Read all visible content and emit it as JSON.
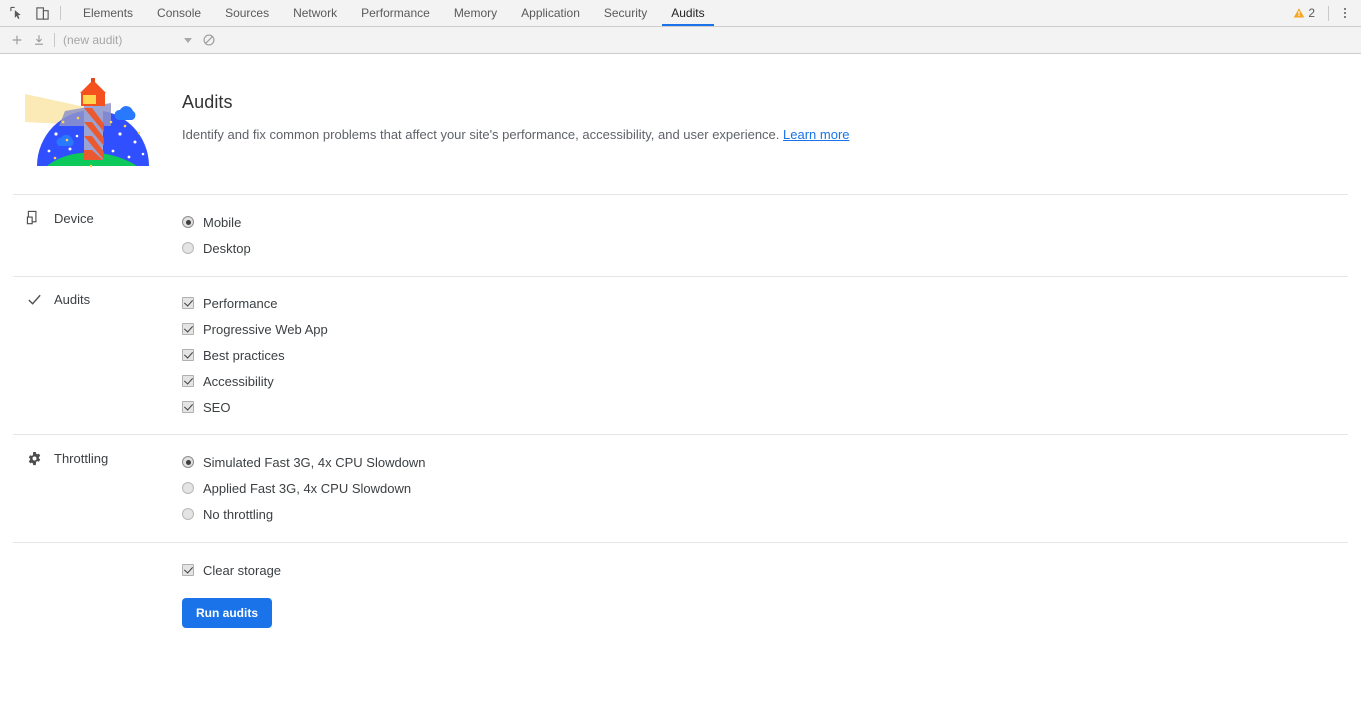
{
  "devtools": {
    "toolbar_icons": {
      "inspect": "inspect-element-icon",
      "device": "device-toolbar-icon"
    },
    "tabs": [
      {
        "label": "Elements",
        "active": false
      },
      {
        "label": "Console",
        "active": false
      },
      {
        "label": "Sources",
        "active": false
      },
      {
        "label": "Network",
        "active": false
      },
      {
        "label": "Performance",
        "active": false
      },
      {
        "label": "Memory",
        "active": false
      },
      {
        "label": "Application",
        "active": false
      },
      {
        "label": "Security",
        "active": false
      },
      {
        "label": "Audits",
        "active": true
      }
    ],
    "warnings": {
      "icon": "warning-triangle-icon",
      "count": "2",
      "color": "#f5a623"
    },
    "more_menu": "more-options-icon",
    "accent_color": "#1a73e8"
  },
  "subtoolbar": {
    "add_label": "+",
    "add_title": "add-audit-button",
    "import_title": "import-audit-button",
    "select_value": "(new audit)",
    "clear_title": "clear-all-button"
  },
  "hero": {
    "logo": "lighthouse-logo",
    "title": "Audits",
    "description": "Identify and fix common problems that affect your site's performance, accessibility, and user experience.",
    "link_label": "Learn more"
  },
  "device": {
    "icon": "device-icon",
    "label": "Device",
    "options": [
      {
        "label": "Mobile",
        "selected": true
      },
      {
        "label": "Desktop",
        "selected": false
      }
    ]
  },
  "audits": {
    "icon": "checkmark-icon",
    "label": "Audits",
    "options": [
      {
        "label": "Performance",
        "checked": true
      },
      {
        "label": "Progressive Web App",
        "checked": true
      },
      {
        "label": "Best practices",
        "checked": true
      },
      {
        "label": "Accessibility",
        "checked": true
      },
      {
        "label": "SEO",
        "checked": true
      }
    ]
  },
  "throttling": {
    "icon": "gear-icon",
    "label": "Throttling",
    "options": [
      {
        "label": "Simulated Fast 3G, 4x CPU Slowdown",
        "selected": true
      },
      {
        "label": "Applied Fast 3G, 4x CPU Slowdown",
        "selected": false
      },
      {
        "label": "No throttling",
        "selected": false
      }
    ]
  },
  "footer": {
    "clear_storage_label": "Clear storage",
    "clear_storage_checked": true,
    "run_button_label": "Run audits"
  }
}
